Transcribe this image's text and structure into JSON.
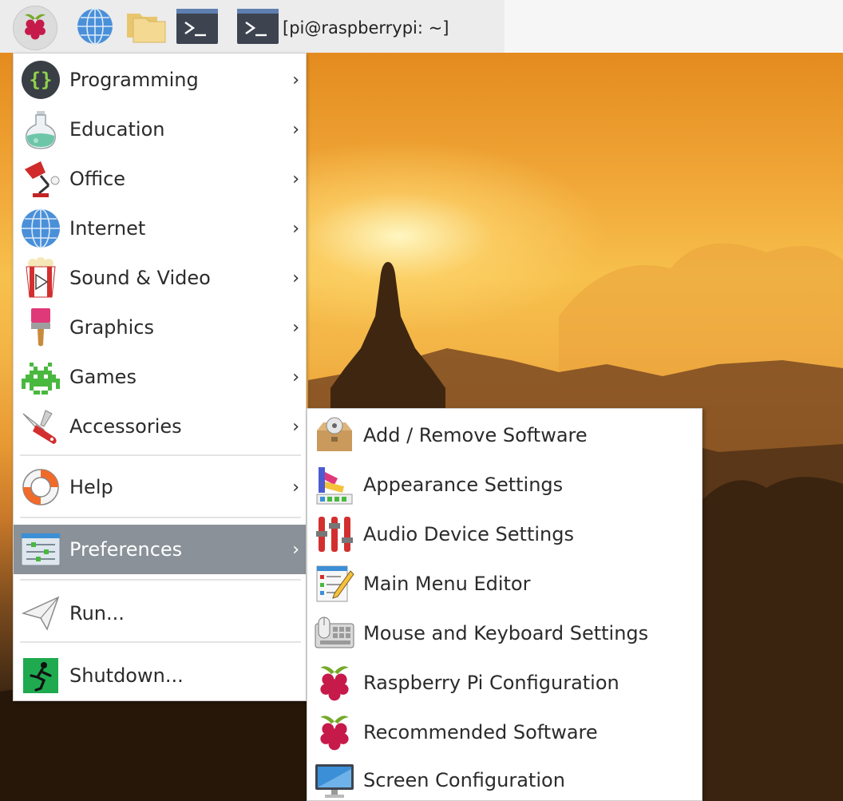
{
  "taskbar": {
    "menu_icon": "raspberry-icon",
    "launchers": [
      {
        "name": "web-browser",
        "icon": "globe-icon"
      },
      {
        "name": "file-manager",
        "icon": "folder-icon"
      },
      {
        "name": "terminal",
        "icon": "terminal-icon"
      }
    ],
    "window_button": {
      "icon": "terminal-icon",
      "label": "[pi@raspberrypi: ~]"
    }
  },
  "main_menu": {
    "items": [
      {
        "label": "Programming",
        "icon": "braces-icon",
        "has_submenu": true
      },
      {
        "label": "Education",
        "icon": "flask-icon",
        "has_submenu": true
      },
      {
        "label": "Office",
        "icon": "lamp-icon",
        "has_submenu": true
      },
      {
        "label": "Internet",
        "icon": "globe-icon",
        "has_submenu": true
      },
      {
        "label": "Sound & Video",
        "icon": "popcorn-icon",
        "has_submenu": true
      },
      {
        "label": "Graphics",
        "icon": "paintbrush-icon",
        "has_submenu": true
      },
      {
        "label": "Games",
        "icon": "space-invader-icon",
        "has_submenu": true
      },
      {
        "label": "Accessories",
        "icon": "pocket-knife-icon",
        "has_submenu": true
      },
      {
        "label": "Help",
        "icon": "lifebuoy-icon",
        "has_submenu": true
      },
      {
        "label": "Preferences",
        "icon": "settings-sliders-icon",
        "has_submenu": true,
        "highlighted": true
      },
      {
        "label": "Run...",
        "icon": "paper-plane-icon",
        "has_submenu": false
      },
      {
        "label": "Shutdown...",
        "icon": "exit-icon",
        "has_submenu": false
      }
    ],
    "arrow": "›"
  },
  "preferences_submenu": {
    "items": [
      {
        "label": "Add / Remove Software",
        "icon": "package-icon"
      },
      {
        "label": "Appearance Settings",
        "icon": "palette-icon"
      },
      {
        "label": "Audio Device Settings",
        "icon": "audio-sliders-icon"
      },
      {
        "label": "Main Menu Editor",
        "icon": "menu-editor-icon"
      },
      {
        "label": "Mouse and Keyboard Settings",
        "icon": "mouse-keyboard-icon"
      },
      {
        "label": "Raspberry Pi Configuration",
        "icon": "raspberry-icon"
      },
      {
        "label": "Recommended Software",
        "icon": "raspberry-icon"
      },
      {
        "label": "Screen Configuration",
        "icon": "monitor-icon"
      }
    ]
  },
  "colors": {
    "menu_highlight": "#8a9198",
    "raspberry_red": "#c51a4a",
    "leaf_green": "#75a928"
  }
}
